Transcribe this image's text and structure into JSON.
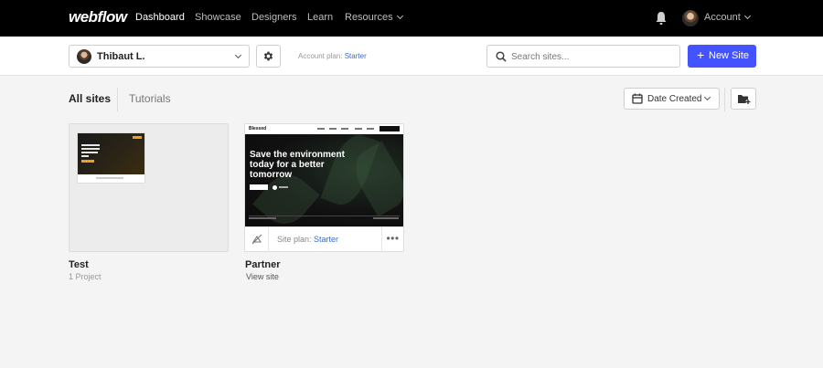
{
  "nav": {
    "logo": "webflow",
    "links": [
      "Dashboard",
      "Showcase",
      "Designers",
      "Learn",
      "Resources"
    ],
    "account": "Account"
  },
  "toolbar": {
    "user_name": "Thibaut L.",
    "plan_label": "Account plan:",
    "plan_value": "Starter",
    "search_placeholder": "Search sites...",
    "new_site_label": "New Site",
    "new_site_plus": "+"
  },
  "tabs": {
    "all": "All sites",
    "tutorials": "Tutorials",
    "sort_label": "Date Created"
  },
  "cards": [
    {
      "title": "Test",
      "subtitle": "1 Project"
    },
    {
      "title": "Partner",
      "subtitle": "View site",
      "site_plan_label": "Site plan:",
      "site_plan_value": "Starter",
      "preview_brand": "Blessed",
      "preview_headline": "Save the environment today for a better tomorrow",
      "more": "•••"
    }
  ],
  "colors": {
    "accent": "#4353ff",
    "link": "#3b6cd4",
    "nav_bg": "#000000"
  }
}
